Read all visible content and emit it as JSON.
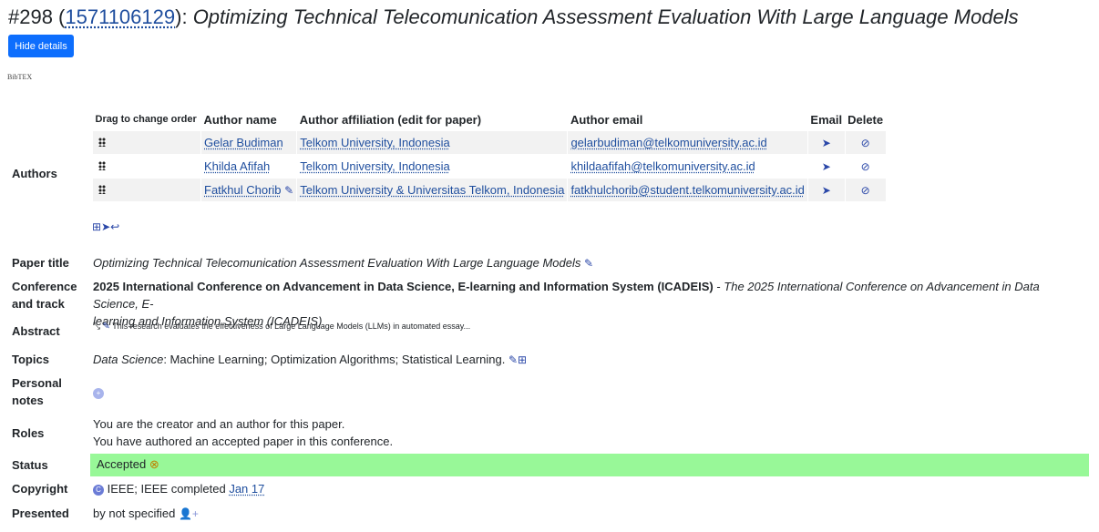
{
  "header": {
    "number": "#298 (",
    "paper_id": "1571106129",
    "sep": "): ",
    "title": "Optimizing Technical Telecomunication Assessment Evaluation With Large Language Models"
  },
  "hide_details_label": "Hide details",
  "bibtex_label": "BibTEX",
  "labels": {
    "authors": "Authors",
    "paper_title": "Paper title",
    "conference_line1": "Conference",
    "conference_line2": "and track",
    "abstract": "Abstract",
    "topics": "Topics",
    "personal_line1": "Personal",
    "personal_line2": "notes",
    "roles": "Roles",
    "status": "Status",
    "copyright": "Copyright",
    "presented": "Presented"
  },
  "author_table": {
    "headers": [
      "Drag to change order",
      "Author name",
      "Author affiliation (edit for paper)",
      "Author email",
      "Email",
      "Delete"
    ],
    "rows": [
      {
        "name": "Gelar Budiman",
        "affiliation": "Telkom University, Indonesia",
        "email": "gelarbudiman@telkomuniversity.ac.id"
      },
      {
        "name": "Khilda Afifah",
        "affiliation": "Telkom University, Indonesia",
        "email": "khildaafifah@telkomuniversity.ac.id"
      },
      {
        "name": "Fatkhul Chorib",
        "affiliation": "Telkom University & Universitas Telkom, Indonesia",
        "email": "fatkhulchorib@student.telkomuniversity.ac.id"
      }
    ]
  },
  "paper_title": "Optimizing Technical Telecomunication Assessment Evaluation With Large Language Models",
  "conference": {
    "name": "2025 International Conference on Advancement in Data Science, E-learning and Information System (ICADEIS)",
    "sep": " - ",
    "track_line1": "The 2025 International Conference on Advancement in Data Science, E-",
    "track_line2": "learning and Information System (ICADEIS)"
  },
  "abstract": "This research evaluates the effectiveness of Large Language Models (LLMs) in automated essay...",
  "topics": {
    "area": "Data Science",
    "list": ": Machine Learning; Optimization Algorithms; Statistical Learning."
  },
  "roles": {
    "line1": "You are the creator and an author for this paper.",
    "line2": "You have authored an accepted paper in this conference."
  },
  "status": "Accepted",
  "copyright": {
    "badge": "C",
    "text": "IEEE; IEEE completed ",
    "date": "Jan 17"
  },
  "presented": "by not specified",
  "colors": {
    "accent": "#0d6efd",
    "status_bg": "#98f898",
    "link": "#1f4e9e"
  }
}
